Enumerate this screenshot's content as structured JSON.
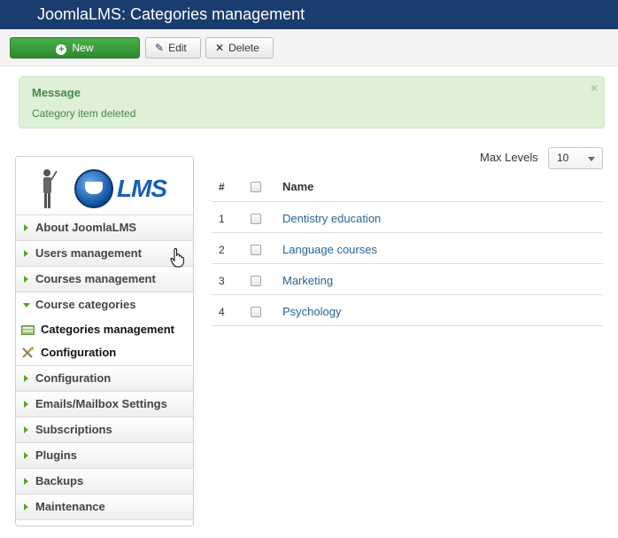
{
  "header": {
    "title": "JoomlaLMS: Categories management"
  },
  "toolbar": {
    "new_label": "New",
    "edit_label": "Edit",
    "delete_label": "Delete"
  },
  "message": {
    "heading": "Message",
    "text": "Category item deleted",
    "close_glyph": "×"
  },
  "sidebar": {
    "logo_text": "LMS",
    "items": [
      {
        "label": "About JoomlaLMS"
      },
      {
        "label": "Users management"
      },
      {
        "label": "Courses management"
      },
      {
        "label": "Course categories"
      },
      {
        "label": "Categories management"
      },
      {
        "label": "Configuration"
      },
      {
        "label": "Configuration"
      },
      {
        "label": "Emails/Mailbox Settings"
      },
      {
        "label": "Subscriptions"
      },
      {
        "label": "Plugins"
      },
      {
        "label": "Backups"
      },
      {
        "label": "Maintenance"
      }
    ]
  },
  "filter": {
    "max_levels_label": "Max Levels",
    "max_levels_value": "10"
  },
  "table": {
    "headers": {
      "num": "#",
      "name": "Name"
    },
    "rows": [
      {
        "num": "1",
        "name": "Dentistry education"
      },
      {
        "num": "2",
        "name": "Language courses"
      },
      {
        "num": "3",
        "name": "Marketing"
      },
      {
        "num": "4",
        "name": "Psychology"
      }
    ]
  }
}
